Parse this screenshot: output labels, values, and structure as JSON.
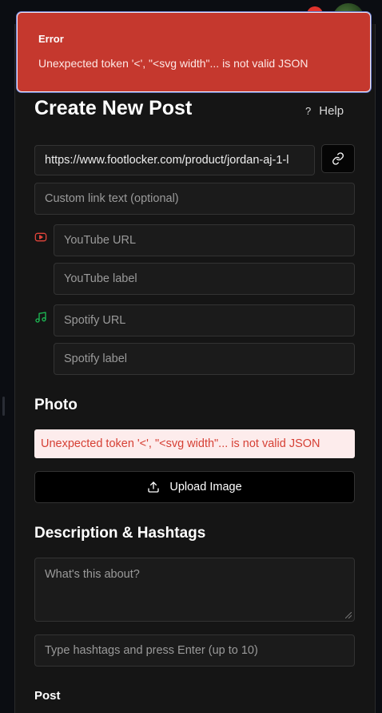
{
  "toast": {
    "title": "Error",
    "message": "Unexpected token '<', \"<svg width\"... is not valid JSON"
  },
  "form": {
    "title": "Create New Post",
    "help_label": "Help",
    "help_glyph": "?",
    "product_url_value": "https://www.footlocker.com/product/jordan-aj-1-l",
    "custom_link_placeholder": "Custom link text (optional)",
    "youtube_url_placeholder": "YouTube URL",
    "youtube_label_placeholder": "YouTube label",
    "spotify_url_placeholder": "Spotify URL",
    "spotify_label_placeholder": "Spotify label"
  },
  "photo": {
    "heading": "Photo",
    "error": "Unexpected token '<', \"<svg width\"... is not valid JSON",
    "upload_label": "Upload Image"
  },
  "description": {
    "heading": "Description & Hashtags",
    "description_placeholder": "What's this about?",
    "hashtags_placeholder": "Type hashtags and press Enter (up to 10)"
  },
  "post_label": "Post",
  "colors": {
    "error_red": "#c5382e",
    "youtube_red": "#e0443a",
    "spotify_green": "#1db954"
  },
  "icons": [
    "link-icon",
    "youtube-icon",
    "music-note-icon",
    "upload-icon"
  ]
}
